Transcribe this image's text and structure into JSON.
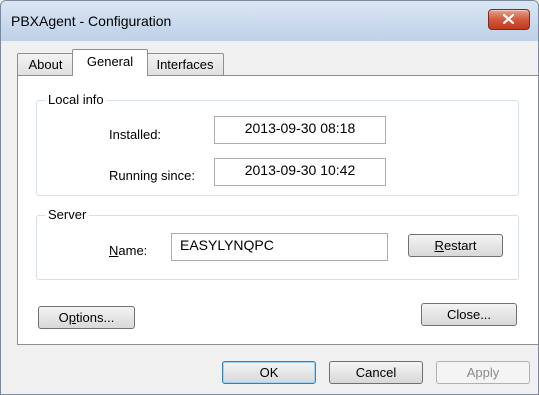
{
  "window": {
    "title": "PBXAgent - Configuration"
  },
  "tabs": [
    {
      "label": "About"
    },
    {
      "label": "General"
    },
    {
      "label": "Interfaces"
    }
  ],
  "local_info": {
    "group_label": "Local info",
    "installed_label": "Installed:",
    "installed_value": "2013-09-30  08:18",
    "running_label": "Running since:",
    "running_value": "2013-09-30  10:42"
  },
  "server": {
    "group_label": "Server",
    "name_label_pre": "N",
    "name_label_post": "ame:",
    "name_value": "EASYLYNQPC",
    "restart_pre": "R",
    "restart_post": "estart"
  },
  "panel_buttons": {
    "options_pre": "O",
    "options_ul": "p",
    "options_post": "tions...",
    "close": "Close..."
  },
  "footer_buttons": {
    "ok": "OK",
    "cancel": "Cancel",
    "apply": "Apply"
  },
  "colors": {
    "close_button": "#c4381a",
    "default_button_border": "#3c7fb1",
    "titlebar": "#c9d9ec"
  }
}
